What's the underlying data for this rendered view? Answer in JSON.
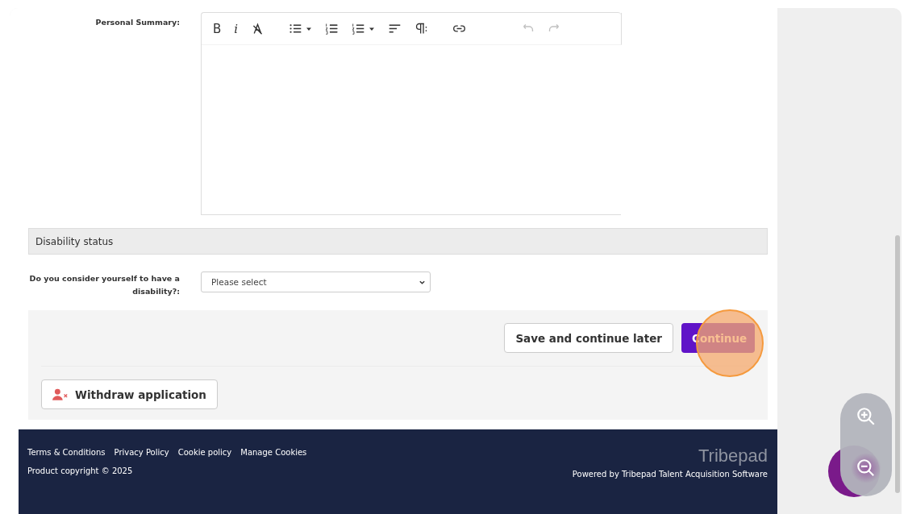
{
  "personal_summary": {
    "label": "Personal Summary:",
    "toolbar": [
      {
        "kind": "bold",
        "label": "B",
        "disabled": false
      },
      {
        "kind": "italic",
        "label": "i",
        "disabled": false
      },
      {
        "kind": "clear-format",
        "disabled": false
      },
      {
        "kind": "bullet-list",
        "disabled": false
      },
      {
        "kind": "numbered-list",
        "disabled": false
      },
      {
        "kind": "numbered-list-dropdown",
        "disabled": false
      },
      {
        "kind": "align",
        "disabled": false
      },
      {
        "kind": "paragraph",
        "disabled": false
      },
      {
        "kind": "link",
        "disabled": false
      },
      {
        "kind": "undo",
        "disabled": true
      },
      {
        "kind": "redo",
        "disabled": true
      }
    ]
  },
  "disability_section": {
    "title": "Disability status",
    "question": {
      "label": "Do you consider yourself to have a disability?:",
      "value": "Please select"
    }
  },
  "actions": {
    "save_later": "Save and continue later",
    "continue": "Continue",
    "withdraw": "Withdraw application"
  },
  "footer": {
    "links": [
      "Terms & Conditions",
      "Privacy Policy",
      "Cookie policy",
      "Manage Cookies"
    ],
    "copyright": "Product copyright © 2025",
    "brand": "Tribepad",
    "powered_by": "Powered by Tribepad Talent Acquisition Software"
  }
}
